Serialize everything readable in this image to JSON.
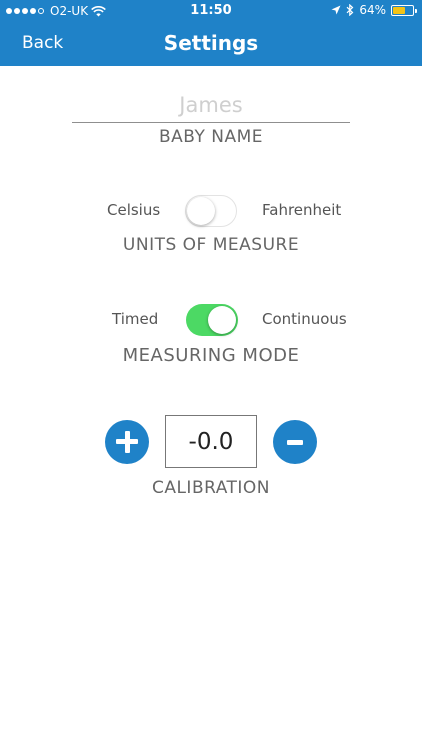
{
  "status_bar": {
    "carrier": "O2-UK",
    "time": "11:50",
    "battery": "64%",
    "battery_level": 0.64,
    "signal_bars_filled": 4,
    "signal_bars_total": 5
  },
  "nav": {
    "back_label": "Back",
    "title": "Settings"
  },
  "baby_name": {
    "placeholder": "James",
    "label": "BABY NAME"
  },
  "units": {
    "left_option": "Celsius",
    "right_option": "Fahrenheit",
    "state": "Celsius",
    "label": "UNITS OF MEASURE"
  },
  "mode": {
    "left_option": "Timed",
    "right_option": "Continuous",
    "state": "Continuous",
    "label": "MEASURING MODE"
  },
  "calibration": {
    "value": "-0.0",
    "label": "CALIBRATION"
  },
  "colors": {
    "accent": "#1f82c8",
    "toggle_on": "#4cd964",
    "battery": "#f3c317"
  }
}
